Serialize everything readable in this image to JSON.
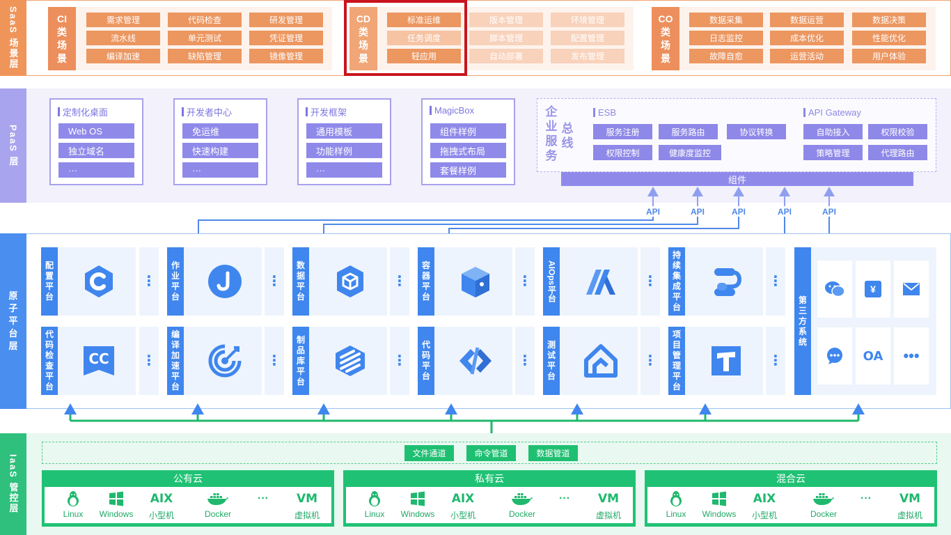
{
  "layers": {
    "saas": "SaaS 场景层",
    "paas": "PaaS 层",
    "atomic": "原子平台层",
    "iaas": "IaaS 管控层"
  },
  "saas": {
    "ci": {
      "title": [
        "CI",
        "类",
        "场",
        "景"
      ],
      "items": [
        "需求管理",
        "代码检查",
        "研发管理",
        "流水线",
        "单元测试",
        "凭证管理",
        "编译加速",
        "缺陷管理",
        "镜像管理"
      ]
    },
    "cd": {
      "title": [
        "CD",
        "类",
        "场",
        "景"
      ],
      "items": [
        "标准运维",
        "版本管理",
        "环境管理",
        "任务调度",
        "脚本管理",
        "配置管理",
        "轻应用",
        "自动部署",
        "发布管理"
      ]
    },
    "co": {
      "title": [
        "CO",
        "类",
        "场",
        "景"
      ],
      "items": [
        "数据采集",
        "数据运营",
        "数据决策",
        "日志监控",
        "成本优化",
        "性能优化",
        "故障自愈",
        "运营活动",
        "用户体验"
      ]
    }
  },
  "paas": {
    "cards": [
      {
        "title": "定制化桌面",
        "items": [
          "Web OS",
          "独立域名",
          "···"
        ]
      },
      {
        "title": "开发者中心",
        "items": [
          "免运维",
          "快速构建",
          "···"
        ]
      },
      {
        "title": "开发框架",
        "items": [
          "通用模板",
          "功能样例",
          "···"
        ]
      },
      {
        "title": "MagicBox",
        "items": [
          "组件样例",
          "拖拽式布局",
          "套餐样例"
        ]
      }
    ],
    "esb": {
      "left_title": [
        "企",
        "业",
        "服",
        "务"
      ],
      "right_title": [
        "总",
        "线"
      ],
      "esb_label": "ESB",
      "esb_items": [
        "服务注册",
        "服务路由",
        "协议转换",
        "权限控制",
        "健康度监控"
      ],
      "gateway_label": "API Gateway",
      "gateway_items": [
        "自助接入",
        "权限校验",
        "策略管理",
        "代理路由"
      ]
    },
    "component_bar": "组件",
    "api_labels": [
      "API",
      "API",
      "API",
      "API",
      "API"
    ]
  },
  "atomic": {
    "row1": [
      {
        "label": [
          "配",
          "置",
          "平",
          "台"
        ],
        "icon": "config-platform-icon"
      },
      {
        "label": [
          "作",
          "业",
          "平",
          "台"
        ],
        "icon": "job-platform-icon"
      },
      {
        "label": [
          "数",
          "据",
          "平",
          "台"
        ],
        "icon": "data-platform-icon"
      },
      {
        "label": [
          "容",
          "器",
          "平",
          "台"
        ],
        "icon": "container-platform-icon"
      },
      {
        "label": [
          "AIOps",
          "平",
          "台"
        ],
        "icon": "aiops-platform-icon"
      },
      {
        "label": [
          "持",
          "续",
          "集",
          "成",
          "平",
          "台"
        ],
        "icon": "ci-platform-icon"
      }
    ],
    "row2": [
      {
        "label": [
          "代",
          "码",
          "检",
          "查",
          "平",
          "台"
        ],
        "icon": "code-check-platform-icon"
      },
      {
        "label": [
          "编",
          "译",
          "加",
          "速",
          "平",
          "台"
        ],
        "icon": "compile-accel-platform-icon"
      },
      {
        "label": [
          "制",
          "品",
          "库",
          "平",
          "台"
        ],
        "icon": "artifact-platform-icon"
      },
      {
        "label": [
          "代",
          "码",
          "平",
          "台"
        ],
        "icon": "code-platform-icon"
      },
      {
        "label": [
          "测",
          "试",
          "平",
          "台"
        ],
        "icon": "test-platform-icon"
      },
      {
        "label": [
          "项",
          "目",
          "管",
          "理",
          "平",
          "台"
        ],
        "icon": "project-mgmt-platform-icon"
      }
    ],
    "third_party": {
      "label": [
        "第",
        "三",
        "方",
        "系",
        "统"
      ],
      "icons": [
        "wechat-icon",
        "payment-icon",
        "mail-icon",
        "chat-icon",
        "oa-icon",
        "more-icon"
      ],
      "oa_text": "OA",
      "yen_text": "¥"
    }
  },
  "iaas": {
    "pipes": [
      "文件通道",
      "命令管道",
      "数据管道"
    ],
    "clouds": [
      {
        "title": "公有云"
      },
      {
        "title": "私有云"
      },
      {
        "title": "混合云"
      }
    ],
    "cloud_items": [
      "Linux",
      "Windows",
      "小型机",
      "Docker",
      "···",
      "虚拟机"
    ],
    "aix_text": "AIX",
    "vm_text": "VM"
  },
  "colors": {
    "saas": "#ec9660",
    "paas": "#8f8aea",
    "atomic": "#3f86ee",
    "iaas": "#1fc274",
    "highlight": "#c8141e"
  }
}
